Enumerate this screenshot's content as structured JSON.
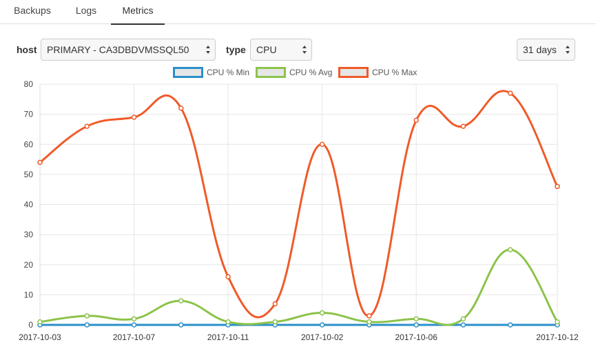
{
  "tabs": [
    {
      "label": "Backups",
      "active": false
    },
    {
      "label": "Logs",
      "active": false
    },
    {
      "label": "Metrics",
      "active": true
    }
  ],
  "controls": {
    "host_label": "host",
    "host_value": "PRIMARY - CA3DBDVMSSQL50",
    "type_label": "type",
    "type_value": "CPU",
    "range_value": "31 days"
  },
  "colors": {
    "min": "#2a8fca",
    "avg": "#8bc34a",
    "max": "#f05a28"
  },
  "chart_data": {
    "type": "line",
    "x_tick_labels": [
      "2017-10-03",
      "2017-10-07",
      "2017-10-11",
      "2017-10-02",
      "2017-10-06",
      "2017-10-12"
    ],
    "ylim": [
      0,
      80
    ],
    "yticks": [
      0,
      10,
      20,
      30,
      40,
      50,
      60,
      70,
      80
    ],
    "grid": true,
    "legend_position": "top-center",
    "series": [
      {
        "name": "CPU % Min",
        "color": "#2a8fca",
        "values": [
          0,
          0,
          0,
          0,
          0,
          0,
          0,
          0,
          0,
          0,
          0,
          0
        ]
      },
      {
        "name": "CPU % Avg",
        "color": "#8bc34a",
        "values": [
          1,
          3,
          2,
          8,
          1,
          1,
          4,
          1,
          2,
          2,
          25,
          1
        ]
      },
      {
        "name": "CPU % Max",
        "color": "#f05a28",
        "values": [
          54,
          66,
          69,
          72,
          16,
          7,
          60,
          3,
          68,
          66,
          77,
          46
        ]
      }
    ]
  }
}
